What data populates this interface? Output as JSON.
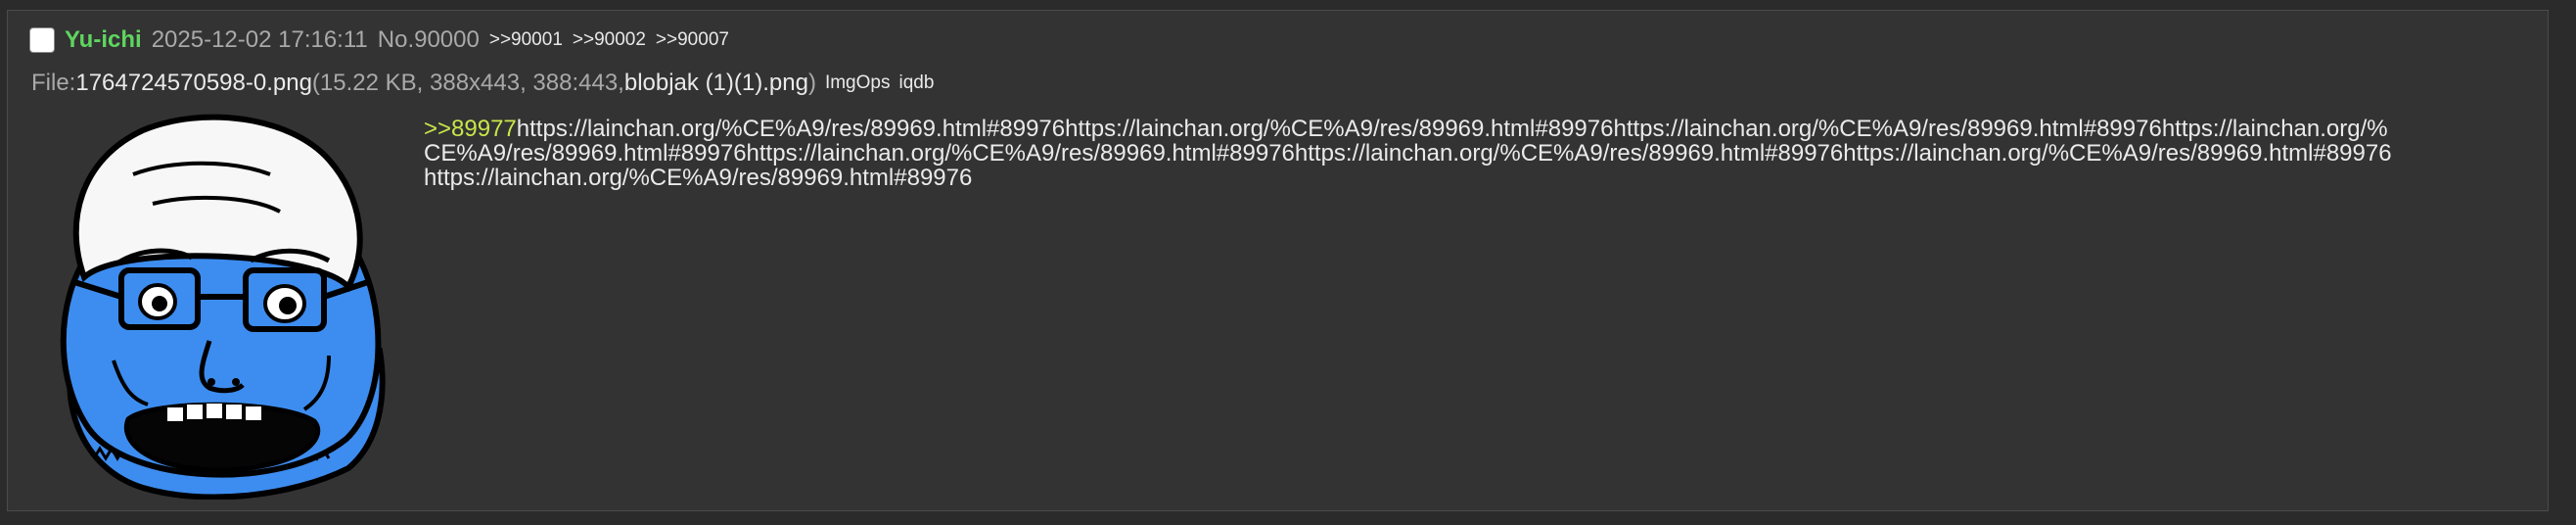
{
  "post": {
    "name": "Yu-ichi",
    "date": "2025-12-02 17:16:11",
    "number": "No.90000",
    "backlinks": [
      ">>90001",
      ">>90002",
      ">>90007"
    ],
    "file": {
      "label": "File: ",
      "filename": "1764724570598-0.png",
      "meta_open": " (15.22 KB, 388x443, 388:443, ",
      "original_name": "blobjak (1)(1).png",
      "meta_close": ")",
      "tools": [
        "ImgOps",
        "iqdb"
      ]
    },
    "thumbnail": {
      "description_icon": "blue-soyjak-image",
      "colors": {
        "skin": "#3d8df0",
        "hat": "#f7f7f7",
        "outline": "#000000"
      }
    },
    "body": {
      "quote": ">>89977",
      "url_text": "https://lainchan.org/%CE%A9/res/89969.html#89976https://lainchan.org/%CE%A9/res/89969.html#89976https://lainchan.org/%CE%A9/res/89969.html#89976https://lainchan.org/%CE%A9/res/89969.html#89976https://lainchan.org/%CE%A9/res/89969.html#89976https://lainchan.org/%CE%A9/res/89969.html#89976https://lainchan.org/%CE%A9/res/89969.html#89976https://lainchan.org/%CE%A9/res/89969.html#89976"
    }
  }
}
